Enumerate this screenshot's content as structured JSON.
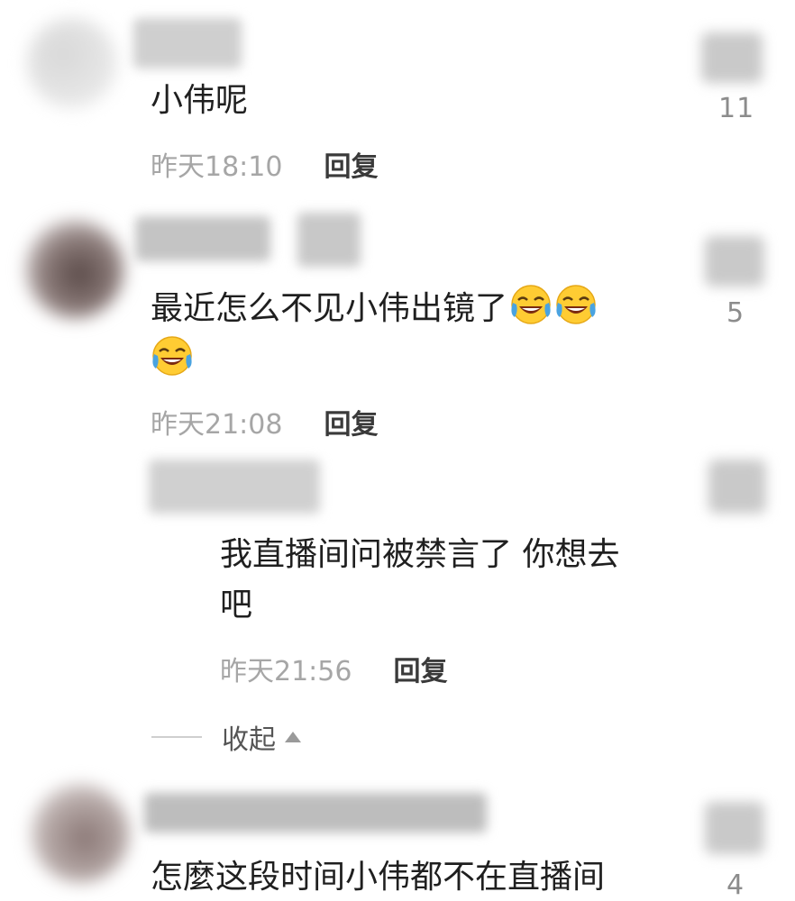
{
  "comments": [
    {
      "text": "小伟呢",
      "time": "昨天18:10",
      "reply_label": "回复",
      "likes": "11"
    },
    {
      "text": "最近怎么不见小伟出镜了",
      "emojis": [
        "laugh-cry-emoji",
        "laugh-cry-emoji",
        "laugh-cry-emoji"
      ],
      "time": "昨天21:08",
      "reply_label": "回复",
      "likes": "5",
      "replies": [
        {
          "text_line1": "我直播间问被禁言了 你想去",
          "text_line2": "吧",
          "time": "昨天21:56",
          "reply_label": "回复"
        }
      ],
      "collapse_label": "收起"
    },
    {
      "text": "怎麼这段时间小伟都不在直播间",
      "likes": "4"
    }
  ],
  "colors": {
    "time": "#a6a6a6",
    "reply": "#3a3a3a",
    "text": "#1f1f1f",
    "likes": "#8c8c8c"
  }
}
